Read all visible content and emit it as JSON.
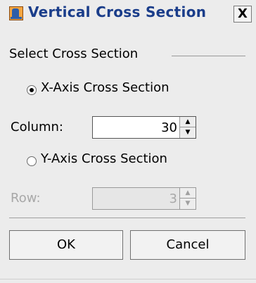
{
  "window": {
    "title": "Vertical Cross Section",
    "close_glyph": "X",
    "icon": "java-cup-icon"
  },
  "group": {
    "label": "Select Cross Section"
  },
  "x_axis": {
    "radio_label": "X-Axis Cross Section",
    "selected": true,
    "field_label": "Column:",
    "value": "30",
    "up_glyph": "▲",
    "down_glyph": "▼"
  },
  "y_axis": {
    "radio_label": "Y-Axis Cross Section",
    "selected": false,
    "field_label": "Row:",
    "value": "3",
    "enabled": false,
    "up_glyph": "▲",
    "down_glyph": "▼"
  },
  "buttons": {
    "ok": "OK",
    "cancel": "Cancel"
  },
  "colors": {
    "title": "#1a3d8a",
    "background": "#ececec",
    "disabled_text": "#a8a8a8"
  }
}
